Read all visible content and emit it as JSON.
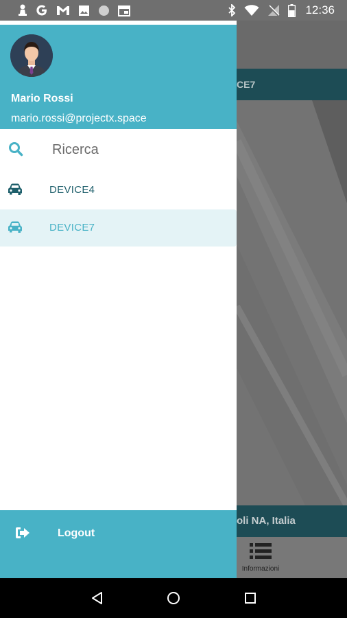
{
  "status_bar": {
    "time": "12:36",
    "left_icons": [
      "chess-pawn-icon",
      "google-icon",
      "gmail-icon",
      "image-icon",
      "circle-icon",
      "calendar-icon"
    ],
    "right_icons": [
      "bluetooth-icon",
      "wifi-icon",
      "no-signal-icon",
      "battery-icon"
    ]
  },
  "drawer": {
    "user": {
      "name": "Mario Rossi",
      "email": "mario.rossi@projectx.space"
    },
    "search": {
      "placeholder": "Ricerca"
    },
    "devices": [
      {
        "label": "DEVICE4",
        "selected": false
      },
      {
        "label": "DEVICE7",
        "selected": true
      }
    ],
    "logout_label": "Logout"
  },
  "background_app": {
    "subheader_text": "CE7",
    "address_text": "oli NA, Italia",
    "bottom_tab_label": "Informazioni"
  },
  "colors": {
    "accent": "#48b2c6",
    "dark_teal": "#1e5f6b",
    "selected_bg": "#e4f3f6"
  }
}
